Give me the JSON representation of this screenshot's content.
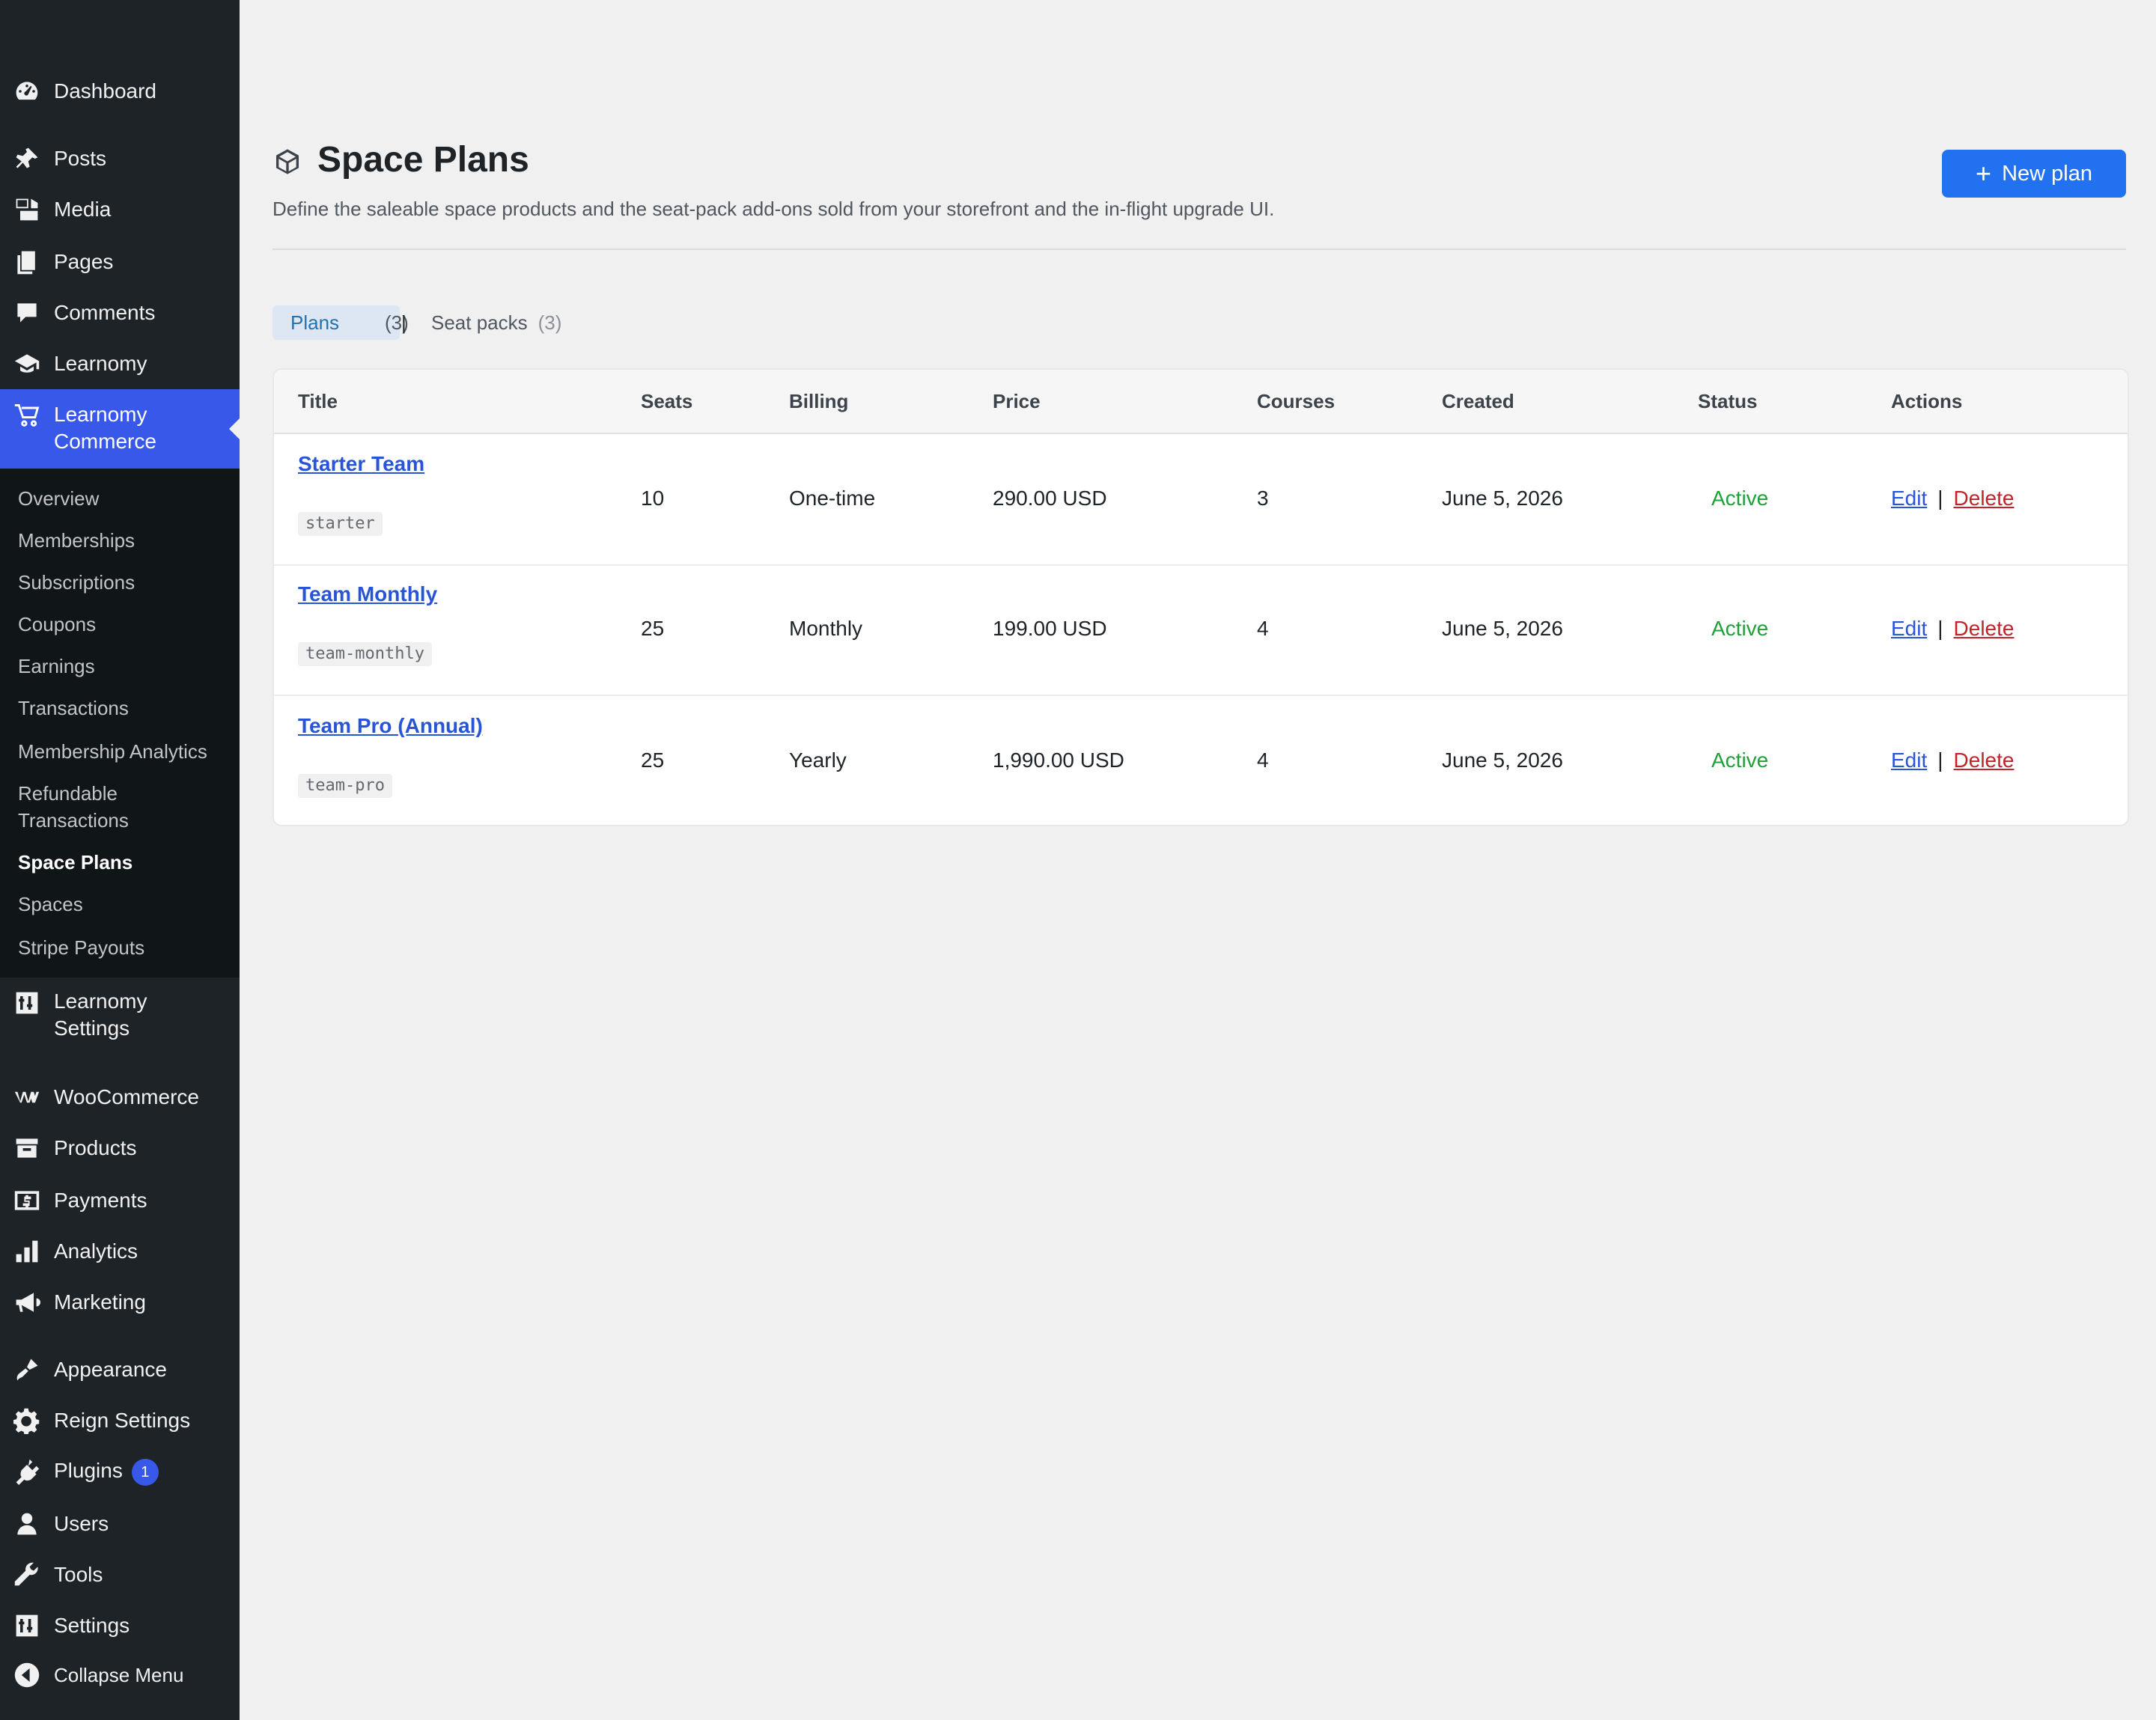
{
  "sidebar": {
    "items": [
      {
        "key": "dashboard",
        "label": "Dashboard",
        "icon": "dashboard-icon"
      },
      {
        "key": "posts",
        "label": "Posts",
        "icon": "pin-icon"
      },
      {
        "key": "media",
        "label": "Media",
        "icon": "media-icon"
      },
      {
        "key": "pages",
        "label": "Pages",
        "icon": "pages-icon"
      },
      {
        "key": "comments",
        "label": "Comments",
        "icon": "comment-icon"
      },
      {
        "key": "learnomy",
        "label": "Learnomy",
        "icon": "graduation-cap-icon"
      },
      {
        "key": "learnomy-commerce",
        "label_line1": "Learnomy",
        "label_line2": "Commerce",
        "icon": "cart-icon"
      },
      {
        "key": "learnomy-settings",
        "label_line1": "Learnomy",
        "label_line2": "Settings",
        "icon": "sliders-icon"
      },
      {
        "key": "woocommerce",
        "label": "WooCommerce",
        "icon": "woocommerce-icon"
      },
      {
        "key": "products",
        "label": "Products",
        "icon": "archive-icon"
      },
      {
        "key": "payments",
        "label": "Payments",
        "icon": "money-icon"
      },
      {
        "key": "analytics",
        "label": "Analytics",
        "icon": "bar-chart-icon"
      },
      {
        "key": "marketing",
        "label": "Marketing",
        "icon": "megaphone-icon"
      },
      {
        "key": "appearance",
        "label": "Appearance",
        "icon": "brush-icon"
      },
      {
        "key": "reign-settings",
        "label": "Reign Settings",
        "icon": "gear-icon"
      },
      {
        "key": "plugins",
        "label": "Plugins",
        "icon": "plug-icon",
        "badge": "1"
      },
      {
        "key": "users",
        "label": "Users",
        "icon": "user-icon"
      },
      {
        "key": "tools",
        "label": "Tools",
        "icon": "wrench-icon"
      },
      {
        "key": "settings",
        "label": "Settings",
        "icon": "sliders-icon"
      },
      {
        "key": "collapse",
        "label": "Collapse Menu",
        "icon": "collapse-arrow-icon"
      }
    ],
    "submenu": [
      "Overview",
      "Memberships",
      "Subscriptions",
      "Coupons",
      "Earnings",
      "Transactions",
      "Membership Analytics",
      "Refundable",
      "Transactions",
      "Space Plans",
      "Spaces",
      "Stripe Payouts"
    ]
  },
  "header": {
    "title": "Space Plans",
    "icon": "box-icon",
    "description": "Define the saleable space products and the seat-pack add-ons sold from your storefront and the in-flight upgrade UI.",
    "new_button": "New plan"
  },
  "tabs": [
    {
      "label": "Plans",
      "count": "(3)"
    },
    {
      "label": "Seat packs",
      "count": "(3)"
    }
  ],
  "tab_separator": "|",
  "table": {
    "columns": [
      "Title",
      "Seats",
      "Billing",
      "Price",
      "Courses",
      "Created",
      "Status",
      "Actions"
    ],
    "rows": [
      {
        "title": "Starter Team",
        "slug": "starter",
        "seats": "10",
        "billing": "One-time",
        "price": "290.00 USD",
        "courses": "3",
        "created": "June 5, 2026",
        "status": "Active",
        "edit": "Edit",
        "sep": "|",
        "delete": "Delete"
      },
      {
        "title": "Team Monthly",
        "slug": "team-monthly",
        "seats": "25",
        "billing": "Monthly",
        "price": "199.00 USD",
        "courses": "4",
        "created": "June 5, 2026",
        "status": "Active",
        "edit": "Edit",
        "sep": "|",
        "delete": "Delete"
      },
      {
        "title": "Team Pro (Annual)",
        "slug": "team-pro",
        "seats": "25",
        "billing": "Yearly",
        "price": "1,990.00 USD",
        "courses": "4",
        "created": "June 5, 2026",
        "status": "Active",
        "edit": "Edit",
        "sep": "|",
        "delete": "Delete"
      }
    ]
  },
  "colors": {
    "sidebar_bg": "#1d2327",
    "accent": "#3858e9",
    "button": "#2271f1",
    "status_active": "#1fa038",
    "delete": "#c3222a"
  }
}
